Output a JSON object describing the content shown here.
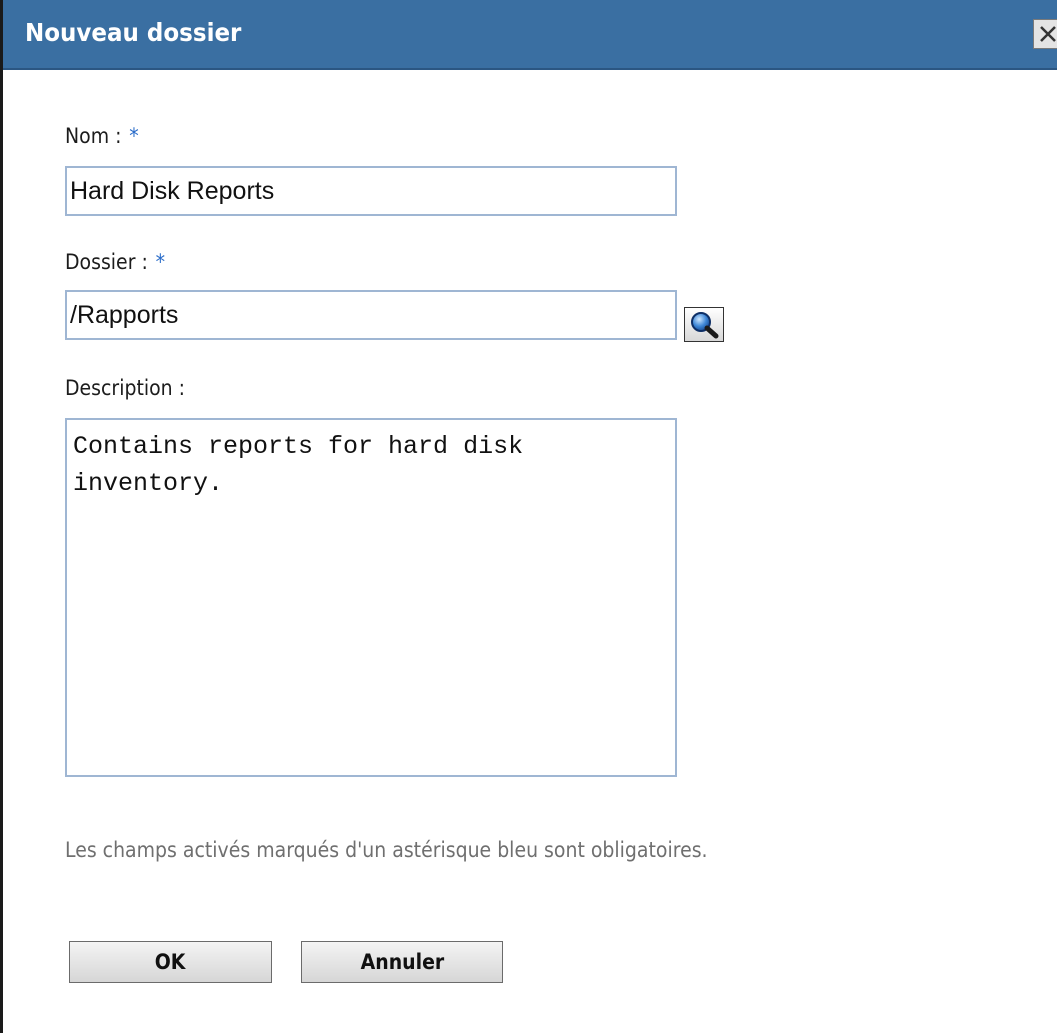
{
  "dialog": {
    "title": "Nouveau dossier",
    "close_icon": "close-icon"
  },
  "form": {
    "name": {
      "label": "Nom :",
      "required_mark": "*",
      "value": "Hard Disk Reports"
    },
    "folder": {
      "label": "Dossier :",
      "required_mark": "*",
      "value": "/Rapports",
      "browse_icon": "magnifier-icon"
    },
    "description": {
      "label": "Description :",
      "value": "Contains reports for hard disk\ninventory."
    },
    "hint": "Les champs activés marqués d'un astérisque bleu sont obligatoires."
  },
  "buttons": {
    "ok": "OK",
    "cancel": "Annuler"
  },
  "colors": {
    "title_bar": "#3a6fa2",
    "required_asterisk": "#2a6cc9",
    "input_border": "#9fb6d3"
  }
}
